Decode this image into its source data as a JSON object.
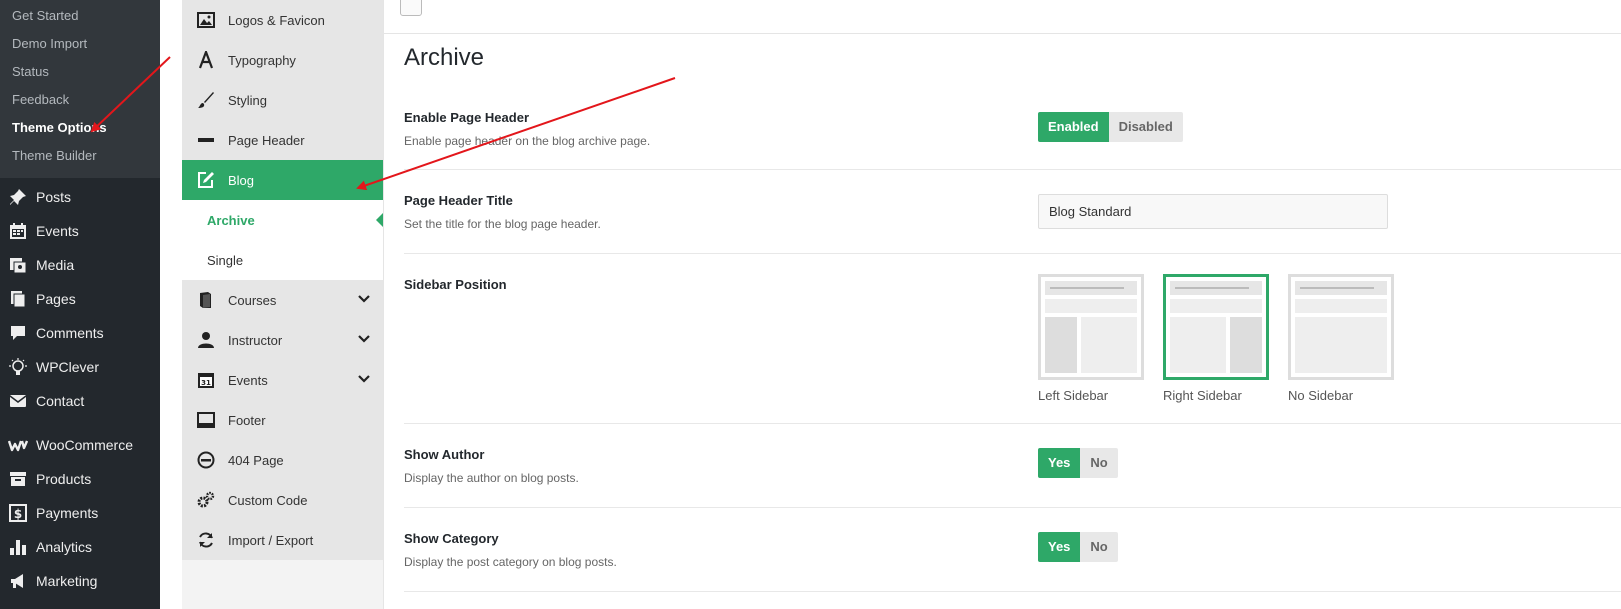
{
  "wp_admin": {
    "submenu": [
      "Get Started",
      "Demo Import",
      "Status",
      "Feedback",
      "Theme Options",
      "Theme Builder"
    ],
    "active_submenu": "Theme Options",
    "menu": [
      {
        "label": "Posts",
        "icon": "pin-icon"
      },
      {
        "label": "Events",
        "icon": "calendar-icon"
      },
      {
        "label": "Media",
        "icon": "media-icon"
      },
      {
        "label": "Pages",
        "icon": "pages-icon"
      },
      {
        "label": "Comments",
        "icon": "comment-icon"
      },
      {
        "label": "WPClever",
        "icon": "bulb-icon"
      },
      {
        "label": "Contact",
        "icon": "mail-icon"
      },
      {
        "label": "WooCommerce",
        "icon": "woo-icon"
      },
      {
        "label": "Products",
        "icon": "archive-icon"
      },
      {
        "label": "Payments",
        "icon": "dollar-icon"
      },
      {
        "label": "Analytics",
        "icon": "bar-chart-icon"
      },
      {
        "label": "Marketing",
        "icon": "megaphone-icon"
      }
    ]
  },
  "options_nav": {
    "items": [
      {
        "label": "Logos & Favicon",
        "icon": "image-icon"
      },
      {
        "label": "Typography",
        "icon": "font-icon"
      },
      {
        "label": "Styling",
        "icon": "brush-icon"
      },
      {
        "label": "Page Header",
        "icon": "minus-icon"
      },
      {
        "label": "Blog",
        "icon": "edit-icon"
      }
    ],
    "blog_sub": [
      "Archive",
      "Single"
    ],
    "items2": [
      {
        "label": "Courses",
        "icon": "book-icon"
      },
      {
        "label": "Instructor",
        "icon": "user-icon"
      },
      {
        "label": "Events",
        "icon": "calendar-icon"
      },
      {
        "label": "Footer",
        "icon": "footer-icon"
      },
      {
        "label": "404 Page",
        "icon": "ban-icon"
      },
      {
        "label": "Custom Code",
        "icon": "cogs-icon"
      },
      {
        "label": "Import / Export",
        "icon": "refresh-icon"
      }
    ]
  },
  "main": {
    "title": "Archive",
    "enable_page_header": {
      "label": "Enable Page Header",
      "desc": "Enable page header on the blog archive page.",
      "on": "Enabled",
      "off": "Disabled"
    },
    "page_header_title": {
      "label": "Page Header Title",
      "desc": "Set the title for the blog page header.",
      "value": "Blog Standard"
    },
    "sidebar_position": {
      "label": "Sidebar Position",
      "options": [
        "Left Sidebar",
        "Right Sidebar",
        "No Sidebar"
      ],
      "selected": "Right Sidebar"
    },
    "show_author": {
      "label": "Show Author",
      "desc": "Display the author on blog posts.",
      "on": "Yes",
      "off": "No"
    },
    "show_category": {
      "label": "Show Category",
      "desc": "Display the post category on blog posts.",
      "on": "Yes",
      "off": "No"
    }
  },
  "colors": {
    "accent": "#2ea868",
    "arrow": "#e3161b"
  }
}
